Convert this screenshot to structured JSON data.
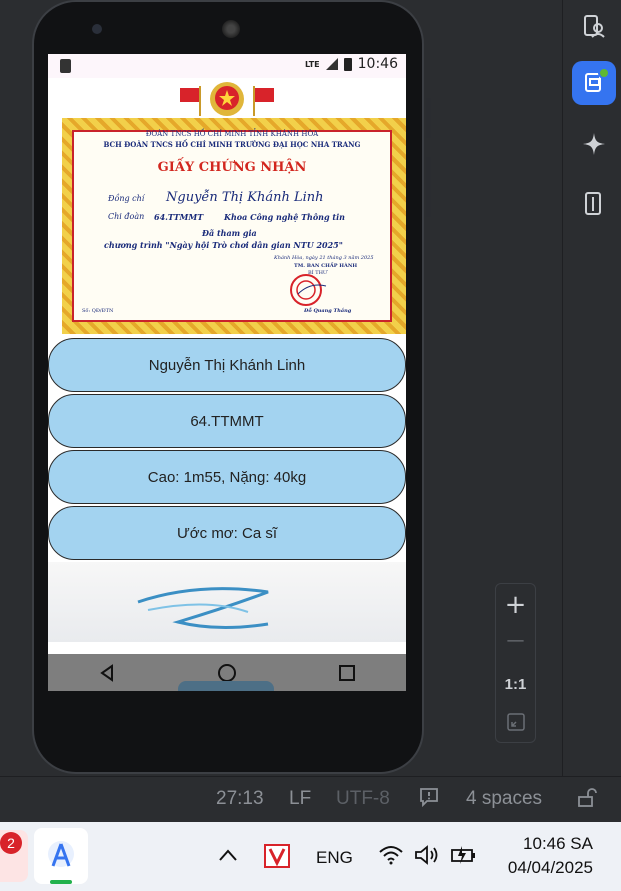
{
  "device": {
    "status_time": "10:46",
    "network": "LTE"
  },
  "certificate": {
    "org_line1": "ĐOÀN TNCS HỒ CHÍ MINH TỈNH KHÁNH HÒA",
    "org_line2": "BCH ĐOÀN TNCS HỒ CHÍ MINH TRƯỜNG ĐẠI HỌC NHA TRANG",
    "title": "GIẤY CHỨNG NHẬN",
    "label_comrade": "Đồng chí",
    "recipient": "Nguyễn Thị Khánh Linh",
    "label_branch": "Chi đoàn",
    "branch": "64.TTMMT",
    "faculty": "Khoa Công nghệ Thông tin",
    "participated": "Đã tham gia",
    "program": "chương trình \"Ngày hội Trò chơi dân gian NTU 2025\"",
    "place_date": "Khánh Hòa, ngày 21 tháng 3 năm 2025",
    "committee": "TM. BAN CHẤP HÀNH",
    "position": "BÍ THƯ",
    "signer": "Đỗ Quang Thắng",
    "number": "Số: QĐ/ĐTN"
  },
  "info_buttons": [
    {
      "label": "Nguyễn Thị Khánh Linh"
    },
    {
      "label": "64.TTMMT"
    },
    {
      "label": "Cao: 1m55, Nặng: 40kg"
    },
    {
      "label": "Ước mơ: Ca sĩ"
    }
  ],
  "zoom_controls": {
    "zoom_in": "+",
    "zoom_out": "—",
    "ratio": "1:1"
  },
  "editor_status": {
    "position": "27:13",
    "line_ending": "LF",
    "encoding": "UTF-8",
    "indent": "4 spaces"
  },
  "taskbar": {
    "badge_count": "2",
    "language": "ENG",
    "time": "10:46 SA",
    "date": "04/04/2025"
  },
  "colors": {
    "button_fill": "#a3d3f0",
    "accent_blue": "#3574f0",
    "cert_red": "#d2261e"
  }
}
